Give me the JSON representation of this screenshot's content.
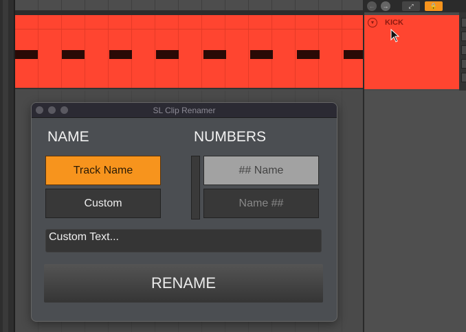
{
  "track": {
    "name": "KICK",
    "clip_color": "#ff4530",
    "note_count": 8
  },
  "dialog": {
    "title": "SL Clip Renamer",
    "name_section": {
      "heading": "NAME",
      "options": [
        "Track Name",
        "Custom"
      ],
      "selected": "Track Name"
    },
    "numbers_section": {
      "heading": "NUMBERS",
      "options": [
        "## Name",
        "Name ##"
      ],
      "selected": "## Name"
    },
    "custom_text_placeholder": "Custom Text...",
    "rename_label": "RENAME"
  },
  "colors": {
    "accent": "#f7941d",
    "clip": "#ff4530"
  }
}
